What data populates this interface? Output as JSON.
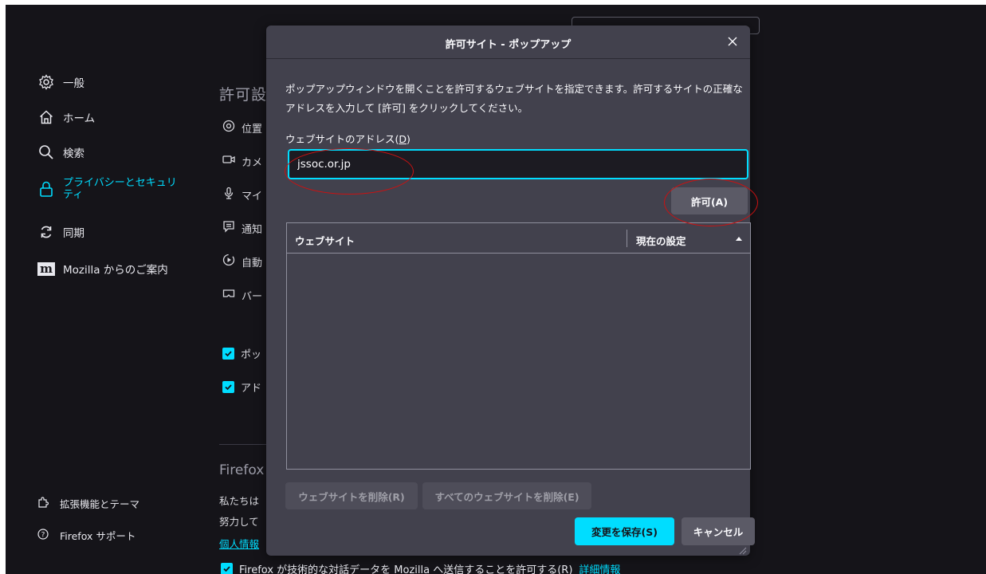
{
  "sidebar": {
    "items": [
      {
        "label": "一般",
        "icon": "gear-icon"
      },
      {
        "label": "ホーム",
        "icon": "home-icon"
      },
      {
        "label": "検索",
        "icon": "search-icon"
      },
      {
        "label": "プライバシーとセキュリティ",
        "label_line1": "プライバシーとセキュリ",
        "label_line2": "ティ",
        "icon": "lock-icon",
        "active": true
      },
      {
        "label": "同期",
        "icon": "sync-icon"
      },
      {
        "label": "Mozilla からのご案内",
        "icon": "mozilla-icon"
      }
    ],
    "footer": [
      {
        "label": "拡張機能とテーマ",
        "icon": "puzzle-icon"
      },
      {
        "label": "Firefox サポート",
        "icon": "help-icon"
      }
    ]
  },
  "background": {
    "heading": "許可設",
    "permissions": [
      {
        "label": "位置",
        "icon": "location-icon"
      },
      {
        "label": "カメ",
        "icon": "camera-icon"
      },
      {
        "label": "マイ",
        "icon": "microphone-icon"
      },
      {
        "label": "通知",
        "icon": "notification-icon"
      },
      {
        "label": "自動",
        "icon": "autoplay-icon"
      },
      {
        "label": "バー",
        "icon": "vr-icon"
      }
    ],
    "checkboxes": [
      {
        "label": "ポッ"
      },
      {
        "label": "アド"
      }
    ],
    "firefox_heading": "Firefox",
    "text_line1": "私たちは",
    "text_line2": "努力して",
    "link_text": "個人情報",
    "bottom_checkbox_label": "Firefox が技術的な対話データを Mozilla へ送信することを許可する(R)",
    "bottom_more_link": "詳細情報"
  },
  "dialog": {
    "title": "許可サイト - ポップアップ",
    "description": "ポップアップウィンドウを開くことを許可するウェブサイトを指定できます。許可するサイトの正確なアドレスを入力して [許可] をクリックしてください。",
    "address_label_prefix": "ウェブサイトのアドレス(",
    "address_label_key": "D",
    "address_label_suffix": ")",
    "address_value": "jssoc.or.jp",
    "allow_button": "許可(A)",
    "table": {
      "col_website": "ウェブサイト",
      "col_status": "現在の設定",
      "rows": []
    },
    "remove_button": "ウェブサイトを削除(R)",
    "remove_all_button": "すべてのウェブサイトを削除(E)",
    "save_button": "変更を保存(S)",
    "cancel_button": "キャンセル"
  },
  "colors": {
    "accent": "#00ddff",
    "page_bg": "#151419",
    "dialog_bg": "#42414d",
    "annotation": "#cc1111"
  }
}
